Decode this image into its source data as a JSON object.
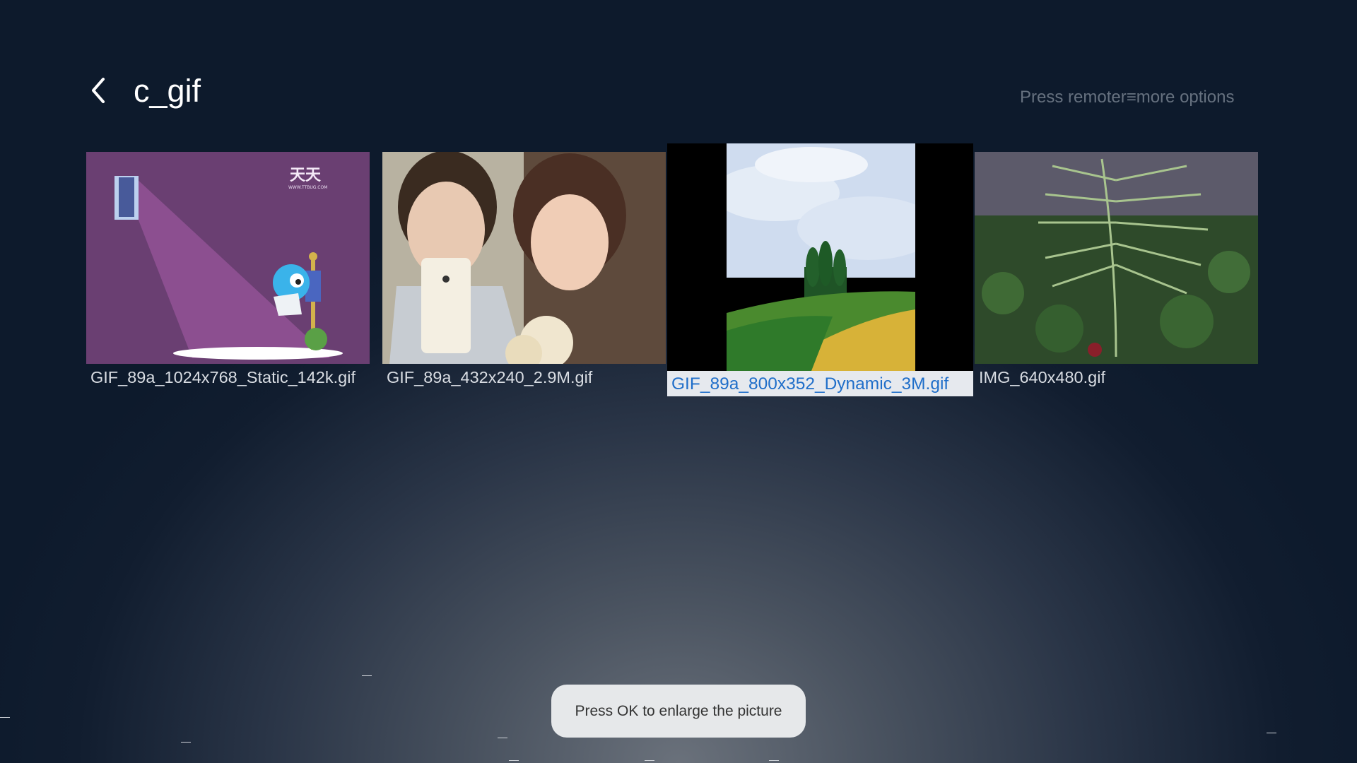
{
  "header": {
    "back_icon": "chevron-left-icon",
    "title": "c_gif",
    "hint_prefix": "Press remoter",
    "hint_menu_glyph": "≡",
    "hint_suffix": "more options"
  },
  "gallery": {
    "items": [
      {
        "filename": "GIF_89a_1024x768_Static_142k.gif",
        "selected": false
      },
      {
        "filename": "GIF_89a_432x240_2.9M.gif",
        "selected": false
      },
      {
        "filename": "GIF_89a_800x352_Dynamic_3M.gif",
        "selected": true
      },
      {
        "filename": "IMG_640x480.gif",
        "selected": false
      }
    ]
  },
  "toast": {
    "text": "Press OK to enlarge the picture"
  },
  "colors": {
    "selected_label": "#1f6ec9",
    "selected_label_bg": "#e6e9ee",
    "background": "#0d1a2c"
  }
}
